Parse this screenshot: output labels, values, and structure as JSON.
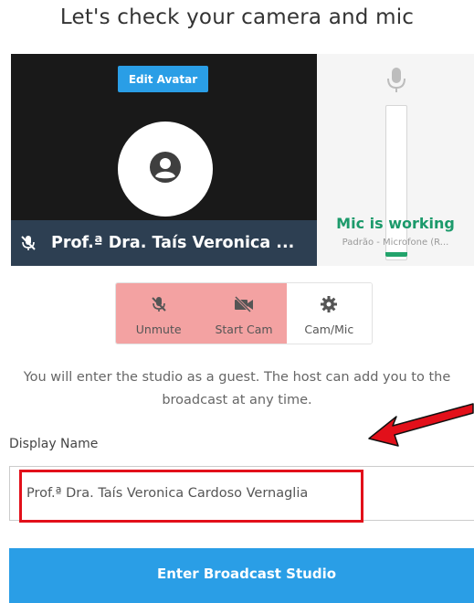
{
  "page": {
    "title": "Let's check your camera and mic"
  },
  "preview": {
    "edit_avatar_label": "Edit Avatar",
    "participant_name": "Prof.ª Dra. Taís Veronica ...",
    "mic_off_icon": "mic-off-icon",
    "avatar_icon": "user-icon"
  },
  "mic": {
    "icon": "microphone-icon",
    "status": "Mic is working",
    "device": "Padrão - Microfone (R...",
    "level": 0.03,
    "level_color": "#22a36b"
  },
  "controls": [
    {
      "label": "Unmute",
      "icon": "mic-off-icon",
      "state": "off"
    },
    {
      "label": "Start Cam",
      "icon": "video-off-icon",
      "state": "off"
    },
    {
      "label": "Cam/Mic",
      "icon": "gear-icon",
      "state": "normal"
    }
  ],
  "info_text": "You will enter the studio as a guest. The host can add you to the broadcast at any time.",
  "display_name": {
    "label": "Display Name",
    "value": "Prof.ª Dra. Taís Veronica Cardoso Vernaglia"
  },
  "enter_button": {
    "label": "Enter Broadcast Studio"
  },
  "colors": {
    "accent": "#2a9ee6",
    "mic_ok": "#1c9a6b",
    "muted_bg": "#f3a2a2",
    "annotation": "#e2101a"
  }
}
